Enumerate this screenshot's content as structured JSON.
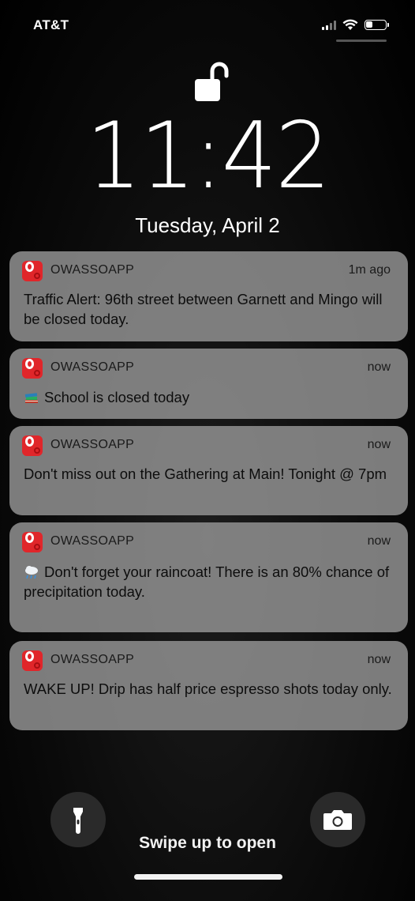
{
  "status_bar": {
    "carrier": "AT&T",
    "icons": [
      "cellular-signal-icon",
      "wifi-icon",
      "battery-icon"
    ],
    "battery_level": 0.35
  },
  "lock_screen": {
    "lock_icon": "unlocked-padlock-icon",
    "time": "11:42",
    "date": "Tuesday, April 2"
  },
  "notifications": [
    {
      "app": "OWASSOAPP",
      "time": "1m ago",
      "emoji": "",
      "text": "Traffic Alert: 96th street between Garnett and Mingo will be closed today."
    },
    {
      "app": "OWASSOAPP",
      "time": "now",
      "emoji": "books-emoji",
      "text": "School is closed today"
    },
    {
      "app": "OWASSOAPP",
      "time": "now",
      "emoji": "",
      "text": "Don't miss out on the Gathering at Main! Tonight @ 7pm"
    },
    {
      "app": "OWASSOAPP",
      "time": "now",
      "emoji": "rain-cloud-emoji",
      "text": "Don't forget your raincoat! There is an 80% chance of precipitation today."
    },
    {
      "app": "OWASSOAPP",
      "time": "now",
      "emoji": "",
      "text": "WAKE UP! Drip has half price espresso shots today only."
    }
  ],
  "bottom": {
    "flashlight_icon": "flashlight-icon",
    "camera_icon": "camera-icon",
    "swipe_label": "Swipe up to open"
  },
  "colors": {
    "app_icon": "#e0262a",
    "notification_bg": "#969696"
  }
}
